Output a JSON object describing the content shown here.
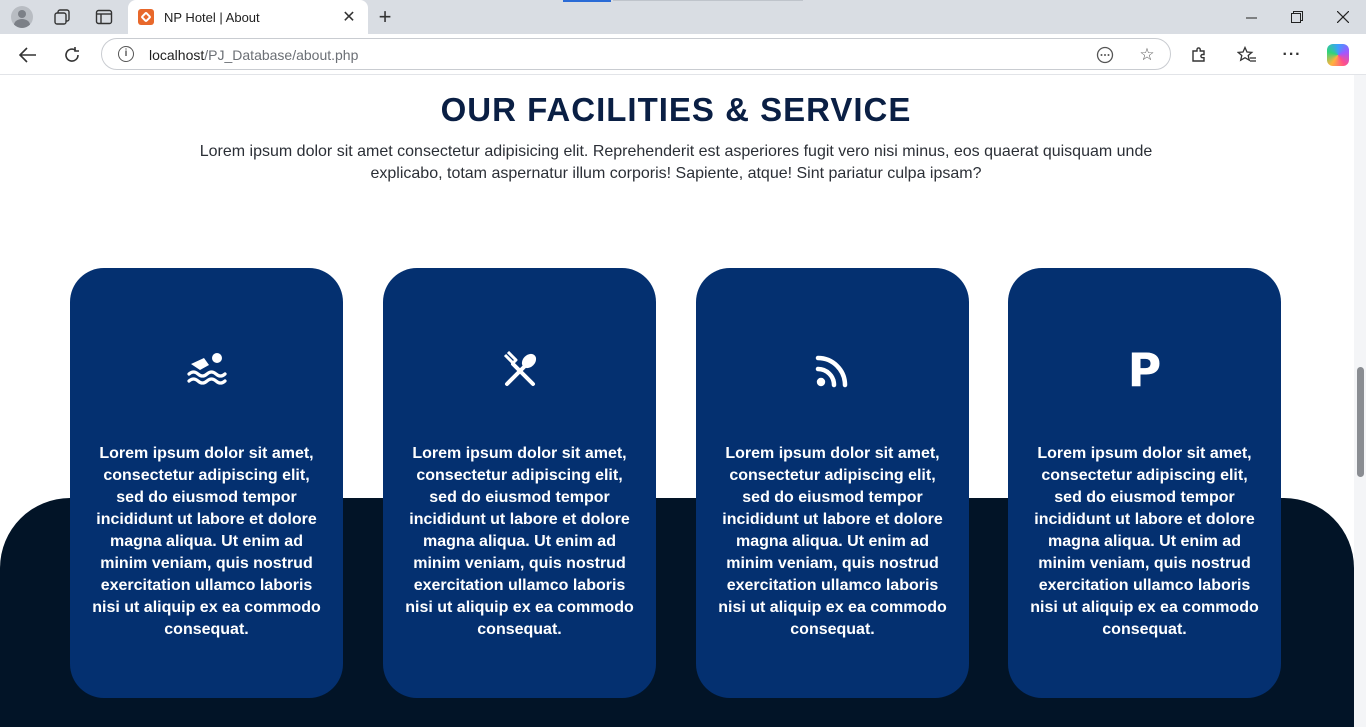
{
  "browser": {
    "tab_title": "NP Hotel | About",
    "url_host": "localhost",
    "url_path": "/PJ_Database/about.php"
  },
  "page": {
    "heading": "OUR FACILITIES & SERVICE",
    "intro": "Lorem ipsum dolor sit amet consectetur adipisicing elit. Reprehenderit est asperiores fugit vero nisi minus, eos quaerat quisquam unde explicabo, totam aspernatur illum corporis! Sapiente, atque! Sint pariatur culpa ipsam?",
    "colors": {
      "card": "#043070",
      "dark_band": "#021427",
      "heading": "#0a1f44"
    },
    "cards": [
      {
        "icon": "swimming-icon",
        "text": "Lorem ipsum dolor sit amet, consectetur adipiscing elit, sed do eiusmod tempor incididunt ut labore et dolore magna aliqua. Ut enim ad minim veniam, quis nostrud exercitation ullamco laboris nisi ut aliquip ex ea commodo consequat."
      },
      {
        "icon": "utensils-icon",
        "text": "Lorem ipsum dolor sit amet, consectetur adipiscing elit, sed do eiusmod tempor incididunt ut labore et dolore magna aliqua. Ut enim ad minim veniam, quis nostrud exercitation ullamco laboris nisi ut aliquip ex ea commodo consequat."
      },
      {
        "icon": "wifi-icon",
        "text": "Lorem ipsum dolor sit amet, consectetur adipiscing elit, sed do eiusmod tempor incididunt ut labore et dolore magna aliqua. Ut enim ad minim veniam, quis nostrud exercitation ullamco laboris nisi ut aliquip ex ea commodo consequat."
      },
      {
        "icon": "parking-icon",
        "glyph": "P",
        "text": "Lorem ipsum dolor sit amet, consectetur adipiscing elit, sed do eiusmod tempor incididunt ut labore et dolore magna aliqua. Ut enim ad minim veniam, quis nostrud exercitation ullamco laboris nisi ut aliquip ex ea commodo consequat."
      }
    ]
  }
}
